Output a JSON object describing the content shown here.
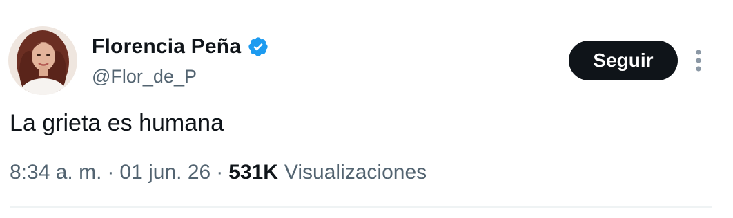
{
  "author": {
    "display_name": "Florencia Peña",
    "handle": "@Flor_de_P",
    "verified": true,
    "verified_badge_color": "#1d9bf0",
    "avatar_icon": "profile-photo"
  },
  "actions": {
    "follow_label": "Seguir",
    "more_icon": "more-vertical-icon"
  },
  "tweet": {
    "text": "La grieta es humana",
    "time": "8:34 a. m.",
    "separator": "·",
    "date": "01 jun. 26",
    "views_count": "531K",
    "views_label": "Visualizaciones"
  },
  "colors": {
    "text_primary": "#0f1419",
    "text_secondary": "#536471",
    "button_bg": "#0f1419",
    "button_text": "#ffffff",
    "divider": "#eff3f4"
  }
}
